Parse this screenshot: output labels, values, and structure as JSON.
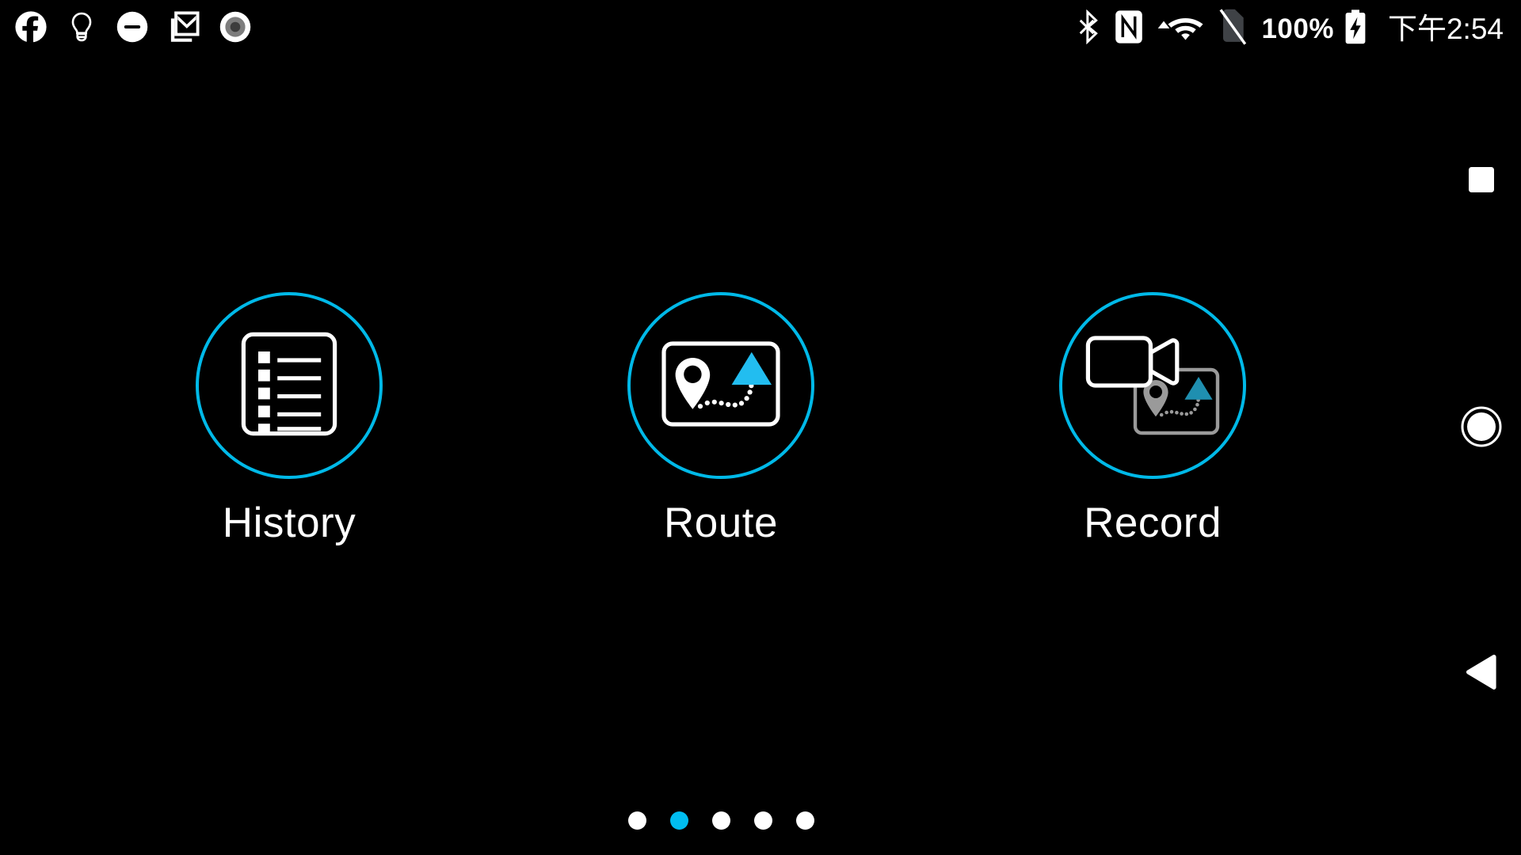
{
  "status_bar": {
    "notifications": [
      {
        "name": "facebook-icon",
        "label": "Facebook"
      },
      {
        "name": "lightbulb-icon",
        "label": "Tips"
      },
      {
        "name": "do-not-disturb-icon",
        "label": "Do not disturb"
      },
      {
        "name": "gmail-icon",
        "label": "Gmail"
      },
      {
        "name": "recording-dot-icon",
        "label": "Screen recording"
      }
    ],
    "system": [
      {
        "name": "bluetooth-icon",
        "label": "Bluetooth"
      },
      {
        "name": "nfc-icon",
        "label": "NFC"
      },
      {
        "name": "wifi-icon",
        "label": "Wi-Fi"
      },
      {
        "name": "no-sim-icon",
        "label": "No SIM card"
      }
    ],
    "battery_level": "100%",
    "battery_charging": true,
    "clock": "下午2:54"
  },
  "apps": [
    {
      "label": "History",
      "icon": "list-document-icon",
      "ring_color": "#00b9e8"
    },
    {
      "label": "Route",
      "icon": "map-route-icon",
      "ring_color": "#00b9e8"
    },
    {
      "label": "Record",
      "icon": "video-map-record-icon",
      "ring_color": "#00b9e8"
    }
  ],
  "page_indicator": {
    "total": 5,
    "active_index": 1,
    "active_color": "#00bdf0",
    "inactive_color": "#ffffff"
  },
  "nav_bar": [
    {
      "name": "recents-button",
      "label": "Recent apps"
    },
    {
      "name": "home-button",
      "label": "Home"
    },
    {
      "name": "back-button",
      "label": "Back"
    }
  ],
  "colors": {
    "background": "#000000",
    "accent_cyan": "#00b9e8",
    "icon_white": "#ffffff",
    "icon_muted": "#9a9a9a",
    "triangle_cyan": "#22bdf0",
    "triangle_muted": "#1f8aa8"
  }
}
